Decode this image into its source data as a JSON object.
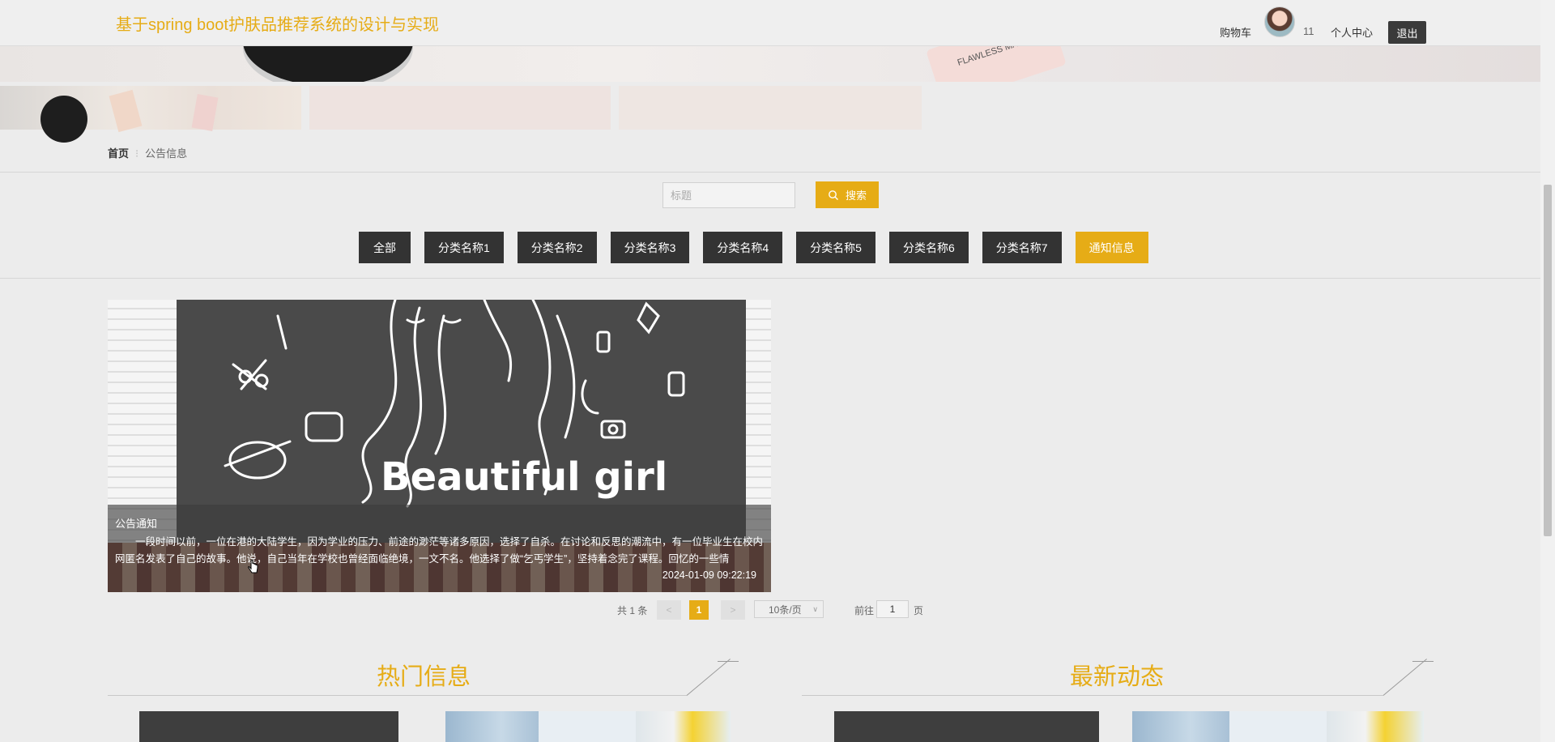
{
  "header": {
    "site_title": "基于spring boot护肤品推荐系统的设计与实现",
    "cart_label": "购物车",
    "username": "11",
    "profile_label": "个人中心",
    "logout_label": "退出"
  },
  "banner": {
    "product_text": "FLAWLESS MAKE-U"
  },
  "breadcrumb": {
    "home": "首页",
    "separator": "⁝",
    "current": "公告信息"
  },
  "search": {
    "placeholder": "标题",
    "button_label": "搜索"
  },
  "categories": {
    "items": [
      "全部",
      "分类名称1",
      "分类名称2",
      "分类名称3",
      "分类名称4",
      "分类名称5",
      "分类名称6",
      "分类名称7",
      "通知信息"
    ],
    "active_index": 8
  },
  "news_card": {
    "image_text": "Beautiful girl",
    "type": "公告通知",
    "description": "一段时间以前，一位在港的大陆学生，因为学业的压力、前途的渺茫等诸多原因，选择了自杀。在讨论和反思的潮流中，有一位毕业生在校内网匿名发表了自己的故事。他说，自己当年在学校也曾经面临绝境，一文不名。他选择了做“乞丐学生”，坚持着念完了课程。回忆的一些情",
    "time": "2024-01-09 09:22:19"
  },
  "pagination": {
    "total": "共 1 条",
    "prev": "<",
    "current": "1",
    "next": ">",
    "page_size": "10条/页",
    "goto_label": "前往",
    "goto_value": "1",
    "page_suffix": "页"
  },
  "sections": {
    "hot": "热门信息",
    "latest": "最新动态"
  },
  "colors": {
    "accent": "#e6ac16",
    "dark_button": "#333333",
    "background": "#ececec"
  }
}
